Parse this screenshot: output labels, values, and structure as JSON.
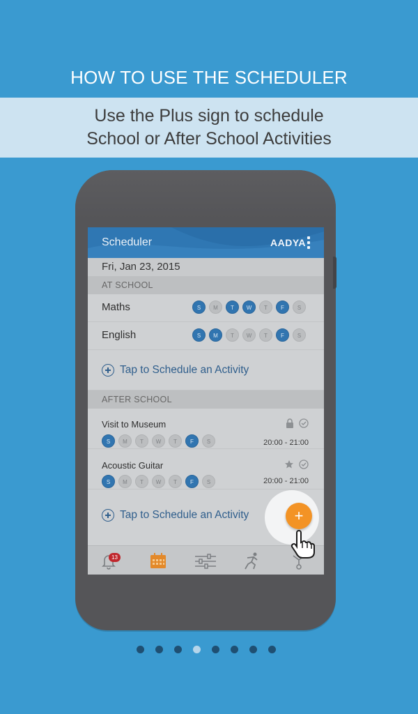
{
  "heading": "HOW TO USE THE SCHEDULER",
  "subheading_line1": "Use the Plus sign to schedule",
  "subheading_line2": "School or After School Activities",
  "app": {
    "title": "Scheduler",
    "logo": "AADYA",
    "date": "Fri, Jan 23, 2015",
    "accent_color": "#2f77b3",
    "fab_color": "#f39325"
  },
  "at_school": {
    "header": "AT SCHOOL",
    "subjects": [
      {
        "name": "Maths",
        "days": [
          "S",
          "M",
          "T",
          "W",
          "T",
          "F",
          "S"
        ],
        "active": [
          true,
          false,
          true,
          true,
          false,
          true,
          false
        ]
      },
      {
        "name": "English",
        "days": [
          "S",
          "M",
          "T",
          "W",
          "T",
          "F",
          "S"
        ],
        "active": [
          true,
          true,
          false,
          false,
          false,
          true,
          false
        ]
      }
    ],
    "tap_label": "Tap to Schedule an Activity"
  },
  "after_school": {
    "header": "AFTER SCHOOL",
    "activities": [
      {
        "name": "Visit to Museum",
        "time": "20:00 - 21:00",
        "status_icon": "lock-icon",
        "days": [
          "S",
          "M",
          "T",
          "W",
          "T",
          "F",
          "S"
        ],
        "active": [
          true,
          false,
          false,
          false,
          false,
          true,
          false
        ]
      },
      {
        "name": "Acoustic Guitar",
        "time": "20:00 - 21:00",
        "status_icon": "star-icon",
        "days": [
          "S",
          "M",
          "T",
          "W",
          "T",
          "F",
          "S"
        ],
        "active": [
          true,
          false,
          false,
          false,
          false,
          true,
          false
        ]
      }
    ],
    "tap_label": "Tap to Schedule an Activity"
  },
  "fab_label": "+",
  "tabbar": {
    "notification_count": "13",
    "tabs": [
      "bell-icon",
      "calendar-icon",
      "sliders-icon",
      "activity-icon",
      "tree-icon"
    ]
  },
  "pager": {
    "count": 8,
    "active_index": 3
  }
}
